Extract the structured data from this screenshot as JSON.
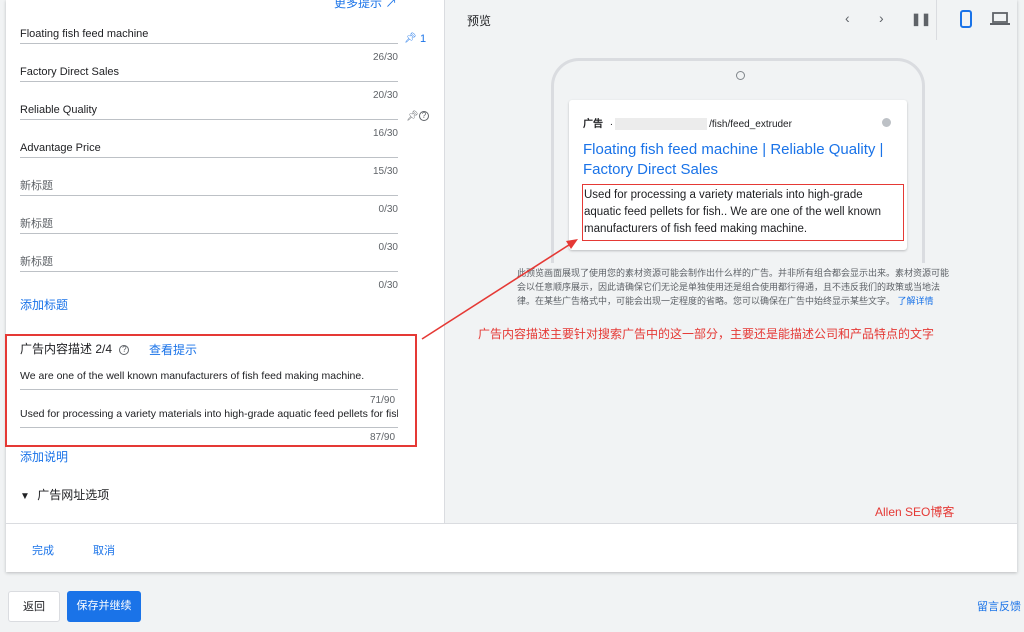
{
  "headlines": {
    "more_tips": "更多提示 ↗",
    "fields": [
      {
        "value": "Floating fish feed machine",
        "count": "26/30",
        "placeholder": false
      },
      {
        "value": "Factory Direct Sales",
        "count": "20/30",
        "placeholder": false
      },
      {
        "value": "Reliable Quality",
        "count": "16/30",
        "placeholder": false
      },
      {
        "value": "Advantage Price",
        "count": "15/30",
        "placeholder": false
      },
      {
        "value": "新标题",
        "count": "0/30",
        "placeholder": true
      },
      {
        "value": "新标题",
        "count": "0/30",
        "placeholder": true
      },
      {
        "value": "新标题",
        "count": "0/30",
        "placeholder": true
      }
    ],
    "pin_count": "1",
    "add_headline": "添加标题"
  },
  "descriptions": {
    "title": "广告内容描述 2/4",
    "view_tips": "查看提示",
    "items": [
      {
        "value": "We are one of the well known manufacturers of fish feed making machine.",
        "count": "71/90"
      },
      {
        "value": "Used for processing a variety materials into high-grade aquatic feed pellets for fish.",
        "count": "87/90"
      }
    ],
    "add_description": "添加说明"
  },
  "url_options": "广告网址选项",
  "actions": {
    "done": "完成",
    "cancel": "取消"
  },
  "preview": {
    "title": "预览",
    "ad_label": "广告",
    "ad_separator": "·",
    "ad_path": "/fish/feed_extruder",
    "ad_title": "Floating fish feed machine | Reliable Quality | Factory Direct Sales",
    "ad_description": "Used for processing a variety materials into high-grade aquatic feed pellets for fish.. We are one of the well known manufacturers of fish feed making machine.",
    "note": "此预览画面展现了使用您的素材资源可能会制作出什么样的广告。并非所有组合都会显示出来。素材资源可能会以任意顺序展示，因此请确保它们无论是单独使用还是组合使用都行得通，且不违反我们的政策或当地法律。在某些广告格式中，可能会出现一定程度的省略。您可以确保在广告中始终显示某些文字。",
    "learn_more": "了解详情"
  },
  "annotation": "广告内容描述主要针对搜索广告中的这一部分，主要还是能描述公司和产品特点的文字",
  "watermark": "Allen SEO博客",
  "footer": {
    "back": "返回",
    "save_continue": "保存并继续",
    "feedback": "留言反馈"
  },
  "colors": {
    "accent": "#1a73e8",
    "annotation_red": "#e53935"
  }
}
